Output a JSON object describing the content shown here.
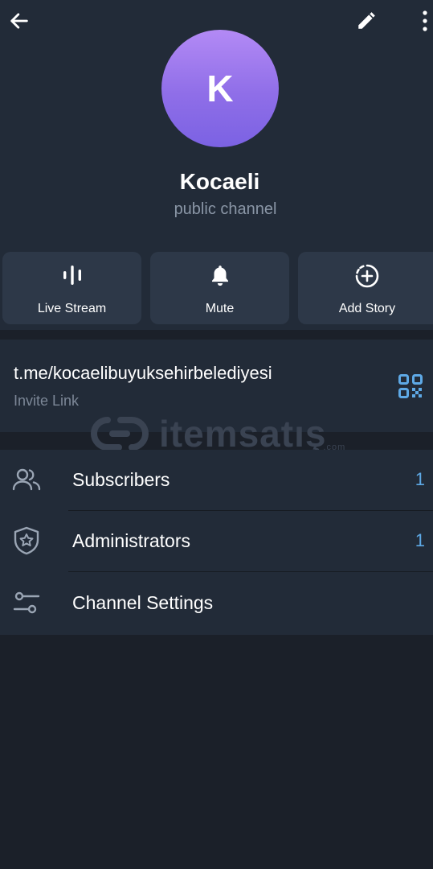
{
  "channel": {
    "avatar_letter": "K",
    "name": "Kocaeli",
    "type": "public channel"
  },
  "colors": {
    "accent": "#5ea9e6",
    "background": "#1b2029",
    "panel": "#222b38",
    "button": "#2d3848"
  },
  "toolbar": {
    "back_icon": "arrow-left-icon",
    "edit_icon": "pencil-icon",
    "more_icon": "more-vertical-icon"
  },
  "actions": [
    {
      "label": "Live Stream",
      "icon": "live-stream-icon"
    },
    {
      "label": "Mute",
      "icon": "bell-icon"
    },
    {
      "label": "Add Story",
      "icon": "add-story-icon"
    }
  ],
  "invite": {
    "url": "t.me/kocaelibuyuksehirbelediyesi",
    "caption": "Invite Link",
    "qr_icon": "qr-code-icon"
  },
  "watermark": {
    "text": "itemsatış",
    "small": ".com"
  },
  "rows": [
    {
      "label": "Subscribers",
      "count": "1",
      "icon": "people-icon"
    },
    {
      "label": "Administrators",
      "count": "1",
      "icon": "shield-star-icon"
    },
    {
      "label": "Channel Settings",
      "count": "",
      "icon": "sliders-icon"
    }
  ]
}
